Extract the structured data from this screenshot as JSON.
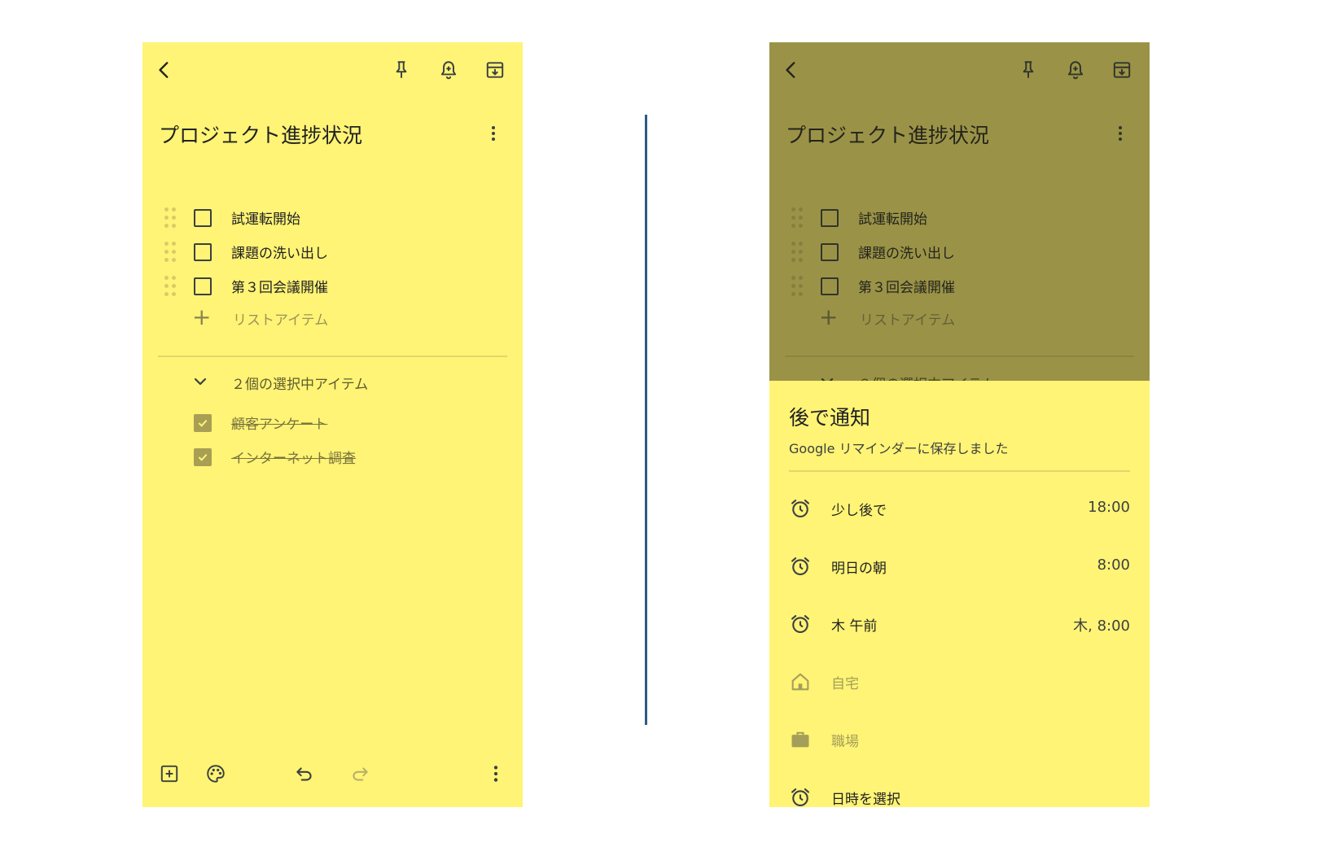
{
  "note": {
    "title": "プロジェクト進捗状況",
    "unchecked_items": [
      {
        "label": "試運転開始"
      },
      {
        "label": "課題の洗い出し"
      },
      {
        "label": "第３回会議開催"
      }
    ],
    "add_item_label": "リストアイテム",
    "checked_header": "２個の選択中アイテム",
    "checked_items": [
      {
        "label": "顧客アンケート"
      },
      {
        "label": "インターネット調査"
      }
    ]
  },
  "reminder_sheet": {
    "title": "後で通知",
    "subtitle": "Google リマインダーに保存しました",
    "options": [
      {
        "label": "少し後で",
        "time": "18:00",
        "icon": "alarm-icon",
        "enabled": true
      },
      {
        "label": "明日の朝",
        "time": "8:00",
        "icon": "alarm-icon",
        "enabled": true
      },
      {
        "label": "木 午前",
        "time": "木, 8:00",
        "icon": "alarm-icon",
        "enabled": true
      },
      {
        "label": "自宅",
        "time": "",
        "icon": "home-icon",
        "enabled": false
      },
      {
        "label": "職場",
        "time": "",
        "icon": "briefcase-icon",
        "enabled": false
      },
      {
        "label": "日時を選択",
        "time": "",
        "icon": "alarm-icon",
        "enabled": true
      }
    ]
  },
  "colors": {
    "note_yellow": "#fff475",
    "divider_blue": "#2b5b86",
    "checked_box": "#a89f55"
  }
}
